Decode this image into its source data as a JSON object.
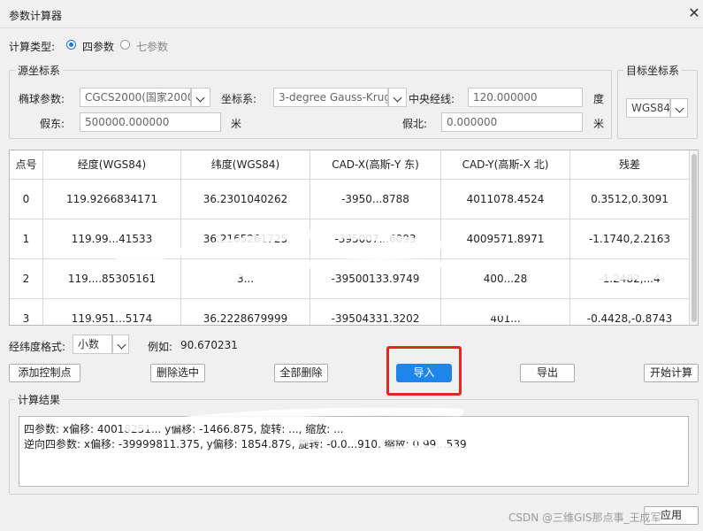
{
  "window": {
    "title": "参数计算器"
  },
  "calc_type": {
    "label": "计算类型:",
    "options": [
      {
        "label": "四参数",
        "selected": true
      },
      {
        "label": "七参数",
        "selected": false
      }
    ]
  },
  "source": {
    "title": "源坐标系",
    "ellipsoid_label": "椭球参数:",
    "ellipsoid_value": "CGCS2000(国家2000)",
    "crs_label": "坐标系:",
    "crs_value": "3-degree Gauss-Krug",
    "cm_label": "中央经线:",
    "cm_value": "120.000000",
    "cm_unit": "度",
    "false_east_label": "假东:",
    "false_east_value": "500000.000000",
    "false_east_unit": "米",
    "false_north_label": "假北:",
    "false_north_value": "0.000000",
    "false_north_unit": "米"
  },
  "target": {
    "title": "目标坐标系",
    "value": "WGS84"
  },
  "table": {
    "headers": [
      "点号",
      "经度(WGS84)",
      "纬度(WGS84)",
      "CAD-X(高斯-Y 东)",
      "CAD-Y(高斯-X 北)",
      "残差"
    ],
    "rows": [
      [
        "0",
        "119.9266834171",
        "36.2301040262",
        "-3950...8788",
        "4011078.4524",
        "0.3512,0.3091"
      ],
      [
        "1",
        "119.99...41533",
        "36.2165261725",
        "-395007...6093",
        "4009571.8971",
        "-1.1740,2.2163"
      ],
      [
        "2",
        "119....85305161",
        "3...",
        "-39500133.9749",
        "400...28",
        "-1.2482,...4"
      ],
      [
        "3",
        "119.951...5174",
        "36.2228679999",
        "-39504331.3202",
        "401...",
        "-0.4428,-0.8743"
      ]
    ]
  },
  "format": {
    "label": "经纬度格式:",
    "value": "小数",
    "example_label": "例如:",
    "example_value": "90.670231"
  },
  "buttons": {
    "add": "添加控制点",
    "delete_selected": "删除选中",
    "delete_all": "全部删除",
    "import": "导入",
    "export": "导出",
    "start": "开始计算",
    "apply": "应用"
  },
  "result": {
    "title": "计算结果",
    "line1": "四参数: x偏移: 40018251... y偏移: -1466.875, 旋转: ..., 缩放: ...",
    "line2": "逆向四参数: x偏移: -39999811.375, y偏移: 1854.879, 旋转: -0.0...910, 缩放: 0.99...539"
  },
  "watermark": "CSDN @三维GIS那点事_王成军"
}
